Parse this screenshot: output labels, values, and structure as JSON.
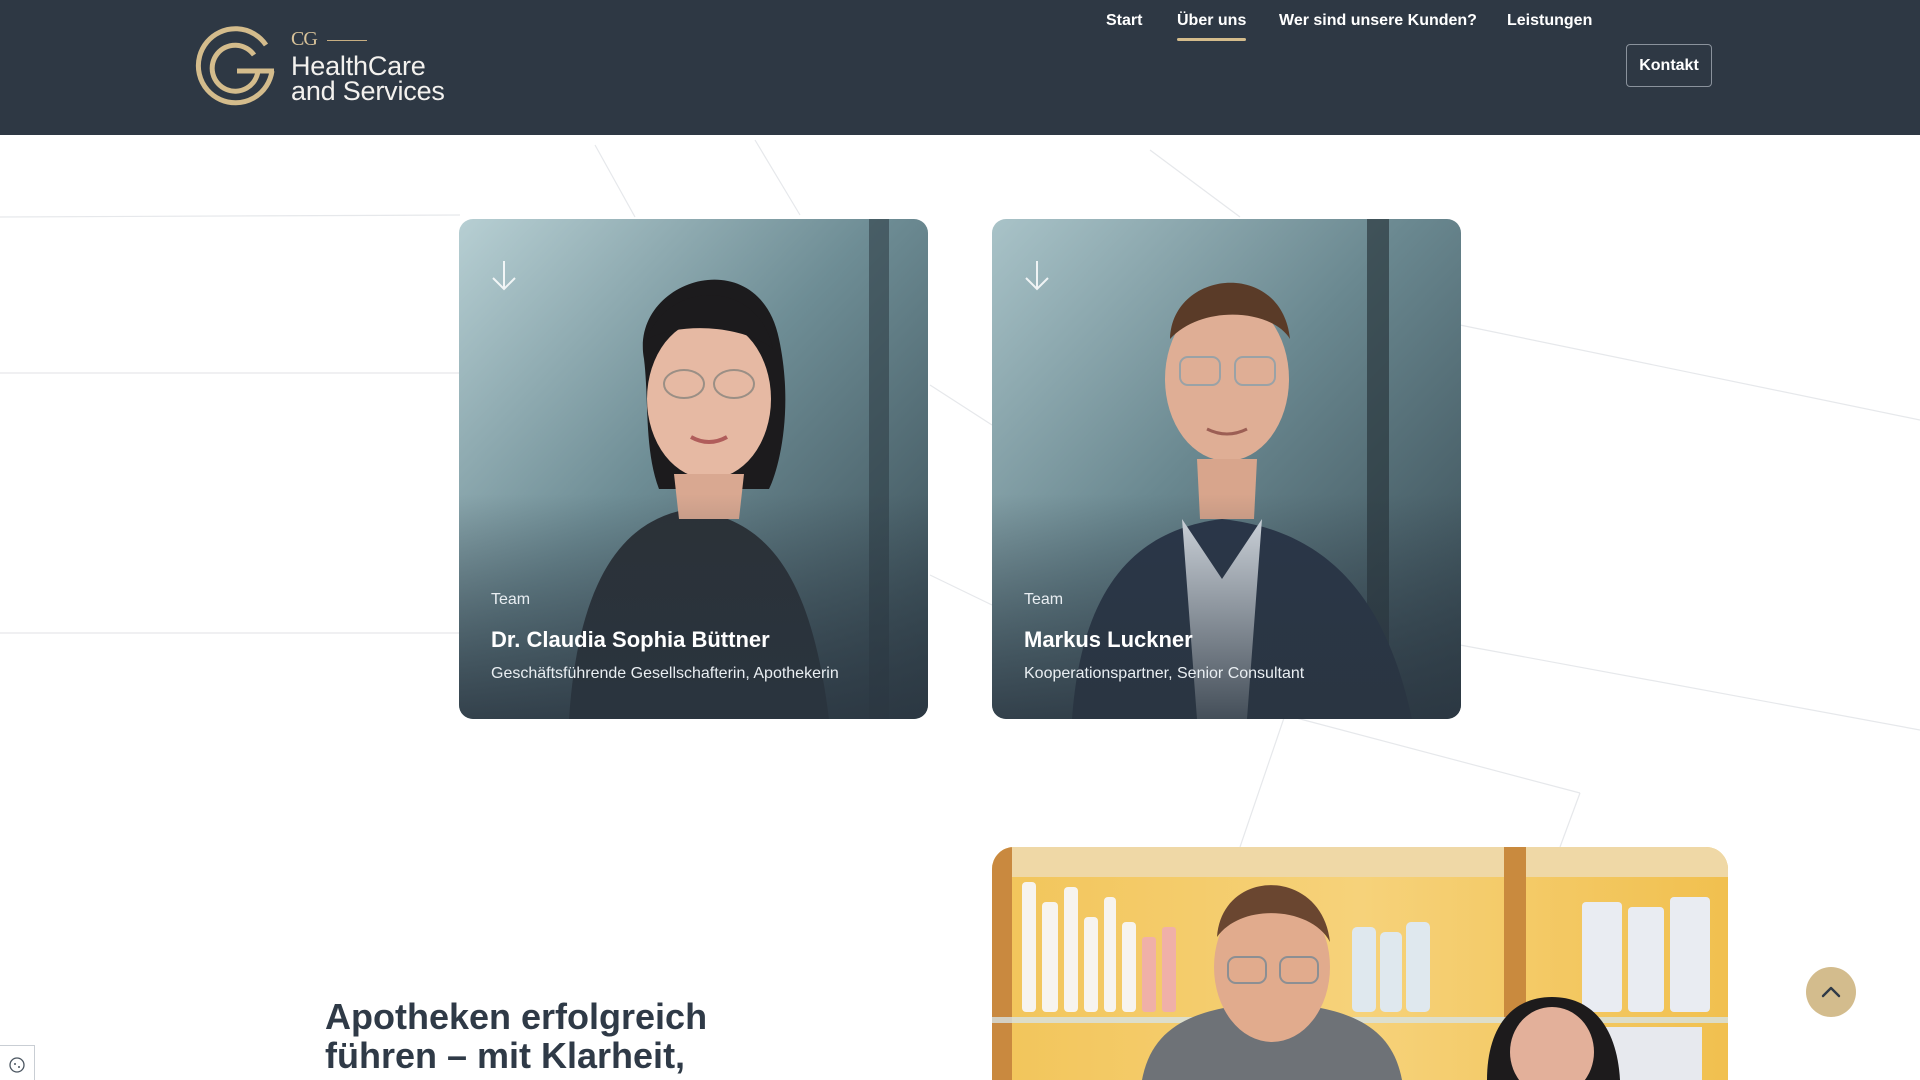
{
  "header": {
    "logo": {
      "monogram": "CG",
      "line1": "HealthCare",
      "line2": "and Services"
    },
    "nav": {
      "items": [
        {
          "label": "Start",
          "active": false
        },
        {
          "label": "Über uns",
          "active": true
        },
        {
          "label": "Wer sind unsere Kunden?",
          "active": false
        },
        {
          "label": "Leistungen",
          "active": false
        }
      ],
      "contact_label": "Kontakt"
    }
  },
  "team": {
    "cards": [
      {
        "category": "Team",
        "name": "Dr. Claudia Sophia Büttner",
        "role": "Geschäftsführende Gesellschafterin, Apothekerin",
        "icon": "arrow-down-icon"
      },
      {
        "category": "Team",
        "name": "Markus Luckner",
        "role": "Kooperationspartner, Senior Consultant",
        "icon": "arrow-down-icon"
      }
    ]
  },
  "intro": {
    "headline_line1": "Apotheken erfolgreich",
    "headline_line2": "führen – mit Klarheit,"
  },
  "widgets": {
    "scroll_top_icon": "chevron-up-icon",
    "cookie_icon": "cookie-settings-icon"
  },
  "colors": {
    "header_bg": "#2e3844",
    "accent_gold": "#d3bc8d",
    "text_dark": "#2f3a47"
  }
}
